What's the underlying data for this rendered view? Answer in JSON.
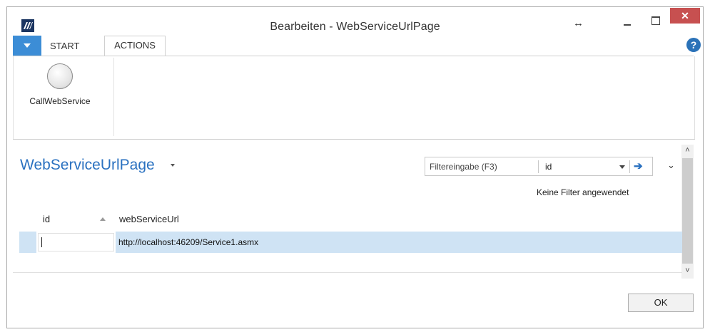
{
  "window": {
    "title": "Bearbeiten - WebServiceUrlPage",
    "resize_glyph": "↔",
    "close_glyph": "✕"
  },
  "ribbon": {
    "tabs": [
      {
        "label": "START"
      },
      {
        "label": "ACTIONS",
        "selected": true
      }
    ],
    "help_glyph": "?",
    "actions": [
      {
        "label": "CallWebService",
        "icon": "circle-icon"
      }
    ]
  },
  "page": {
    "title": "WebServiceUrlPage",
    "filter": {
      "placeholder": "Filtereingabe (F3)",
      "field": "id",
      "go_glyph": "➔"
    },
    "filter_status": "Keine Filter angewendet",
    "expand_glyph": "⌄"
  },
  "table": {
    "columns": [
      "id",
      "webServiceUrl"
    ],
    "sorted_column": "id",
    "rows": [
      {
        "id": "",
        "webServiceUrl": "http://localhost:46209/Service1.asmx"
      }
    ]
  },
  "scrollbar": {
    "up_glyph": "˄",
    "down_glyph": "˅"
  },
  "footer": {
    "ok_label": "OK"
  },
  "colors": {
    "accent": "#2a71c0",
    "selection": "#cfe3f4",
    "close": "#c75050",
    "app_menu": "#3c8dd6"
  }
}
